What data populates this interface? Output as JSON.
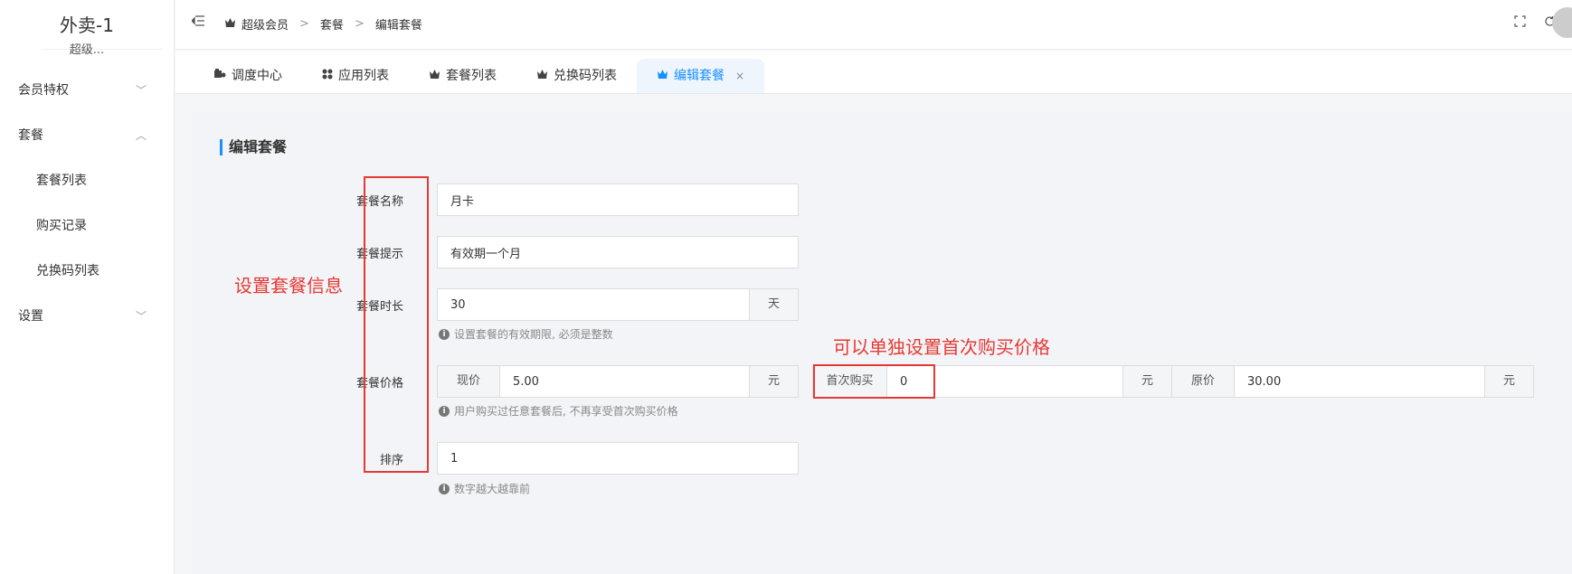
{
  "brand": {
    "name": "外卖-1",
    "sub": "超级..."
  },
  "sidebar": {
    "items": [
      {
        "label": "会员特权",
        "chevron": "﹀"
      },
      {
        "label": "套餐",
        "chevron": "︿"
      },
      {
        "label": "设置",
        "chevron": "﹀"
      }
    ],
    "sub_items": [
      "套餐列表",
      "购买记录",
      "兑换码列表"
    ]
  },
  "header": {
    "breadcrumb": [
      "超级会员",
      "套餐",
      "编辑套餐"
    ],
    "separator": ">"
  },
  "tabs": [
    {
      "label": "调度中心",
      "icon": "dashboard-icon"
    },
    {
      "label": "应用列表",
      "icon": "apps-icon"
    },
    {
      "label": "套餐列表",
      "icon": "crown-icon"
    },
    {
      "label": "兑换码列表",
      "icon": "crown-icon"
    },
    {
      "label": "编辑套餐",
      "icon": "crown-icon",
      "active": true,
      "close": "×"
    }
  ],
  "form": {
    "title": "编辑套餐",
    "name_label": "套餐名称",
    "name_value": "月卡",
    "tip_label": "套餐提示",
    "tip_value": "有效期一个月",
    "duration_label": "套餐时长",
    "duration_value": "30",
    "duration_unit": "天",
    "duration_hint": "设置套餐的有效期限, 必须是整数",
    "price_label": "套餐价格",
    "current_price_label": "现价",
    "current_price_value": "5.00",
    "currency_unit": "元",
    "first_buy_label": "首次购买",
    "first_buy_value": "0",
    "original_price_label": "原价",
    "original_price_value": "30.00",
    "price_hint": "用户购买过任意套餐后, 不再享受首次购买价格",
    "sort_label": "排序",
    "sort_value": "1",
    "sort_hint": "数字越大越靠前",
    "hint_icon_glyph": "i"
  },
  "annotations": {
    "left": "设置套餐信息",
    "right": "可以单独设置首次购买价格"
  },
  "colors": {
    "accent": "#1890ff",
    "annotation_red": "#e53935"
  }
}
